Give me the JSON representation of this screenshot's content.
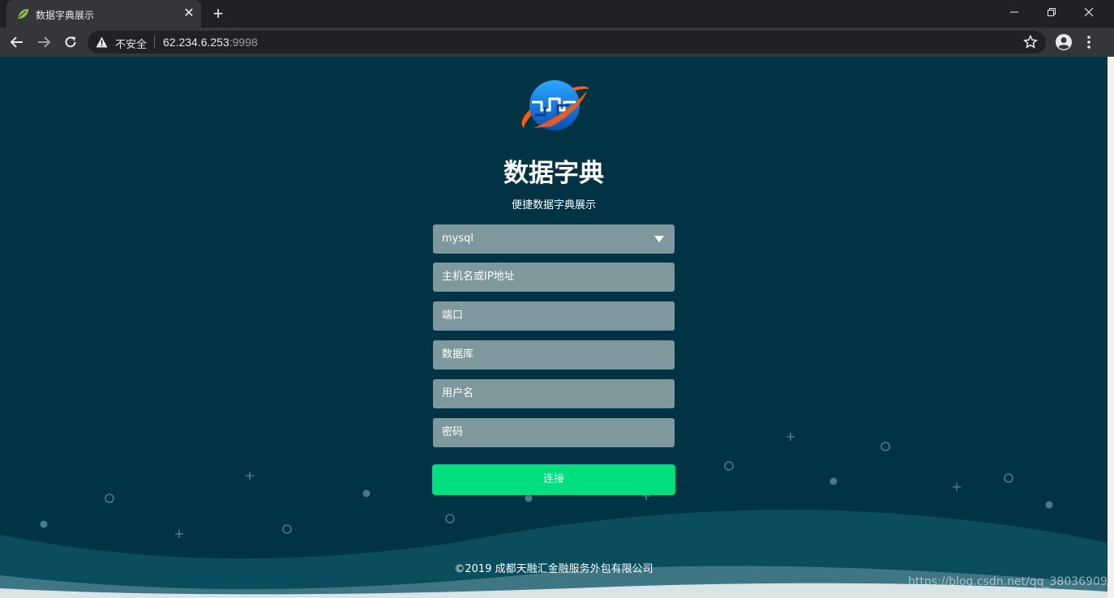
{
  "browser": {
    "tab_title": "数据字典展示",
    "tab_close": "✕",
    "new_tab": "+",
    "security_label": "不安全",
    "url_host": "62.234.6.253",
    "url_port": ":9998"
  },
  "page": {
    "title": "数据字典",
    "subtitle": "便捷数据字典展示",
    "db_type": {
      "selected": "mysql"
    },
    "fields": {
      "host_placeholder": "主机名或IP地址",
      "port_placeholder": "端口",
      "database_placeholder": "数据库",
      "username_placeholder": "用户名",
      "password_placeholder": "密码"
    },
    "connect_label": "连接",
    "copyright": "©2019 成都天融汇金融服务外包有限公司",
    "watermark": "https://blog.csdn.net/qq_38036909"
  },
  "colors": {
    "background": "#003343",
    "field": "#7f989d",
    "button": "#00de7e",
    "wave": "#0a4e5e"
  }
}
